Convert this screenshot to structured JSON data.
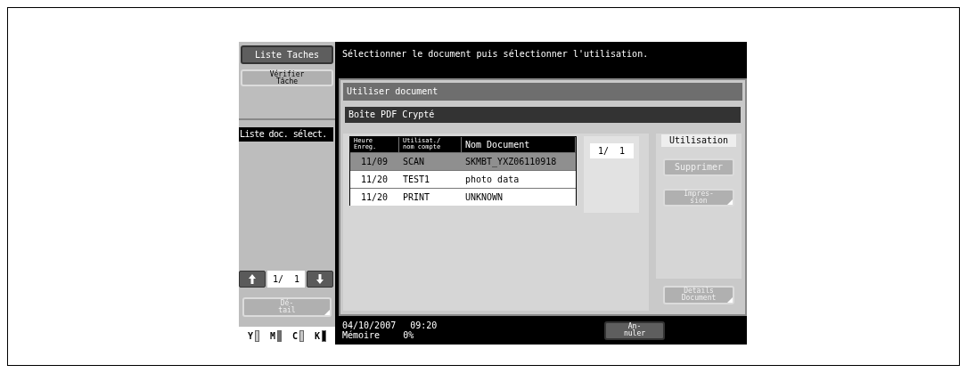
{
  "left_panel": {
    "buttons": [
      {
        "label": "Liste Taches",
        "kind": "dark",
        "disabled": false,
        "submenu": false
      },
      {
        "label": "Vérifier\nTâche",
        "kind": "light",
        "disabled": false,
        "submenu": false
      }
    ],
    "section_label": "Liste doc. sélect.",
    "pager": "1/  1",
    "detail_button": {
      "label": "Dé-\ntail",
      "kind": "light",
      "disabled": true,
      "submenu": true
    },
    "toner": [
      {
        "label": "Y",
        "color": "#c8c8c8"
      },
      {
        "label": "M",
        "color": "#707070"
      },
      {
        "label": "C",
        "color": "#c8c8c8"
      },
      {
        "label": "K",
        "color": "#000000"
      }
    ]
  },
  "message": "Sélectionner le document puis sélectionner l'utilisation.",
  "panel": {
    "title": "Utiliser document",
    "box_name": "Boîte PDF Crypté",
    "table": {
      "columns": [
        "Heure\nEnreg.",
        "Utilisat./\nnom compte",
        "Nom Document"
      ],
      "rows": [
        {
          "cells": [
            "11/09",
            "SCAN",
            "SKMBT_YXZ06110918"
          ],
          "selected": true
        },
        {
          "cells": [
            "11/20",
            "TEST1",
            "photo data"
          ],
          "selected": false
        },
        {
          "cells": [
            "11/20",
            "PRINT",
            "UNKNOWN"
          ],
          "selected": false
        }
      ]
    },
    "page_counter": "1/  1",
    "actions": {
      "title": "Utilisation",
      "buttons": [
        {
          "label": "Supprimer",
          "kind": "light",
          "disabled": true,
          "submenu": false
        },
        {
          "label": "Impres-\nsion",
          "kind": "light",
          "disabled": true,
          "submenu": true
        }
      ]
    },
    "details_button": {
      "label": "Details\nDocument",
      "kind": "light",
      "disabled": true,
      "submenu": true
    }
  },
  "status": {
    "date": "04/10/2007",
    "time": "09:20",
    "memory_label": "Mémoire",
    "memory": "0%"
  },
  "cancel_button": {
    "label": "An-\nnuler",
    "kind": "dark",
    "disabled": false,
    "submenu": false
  }
}
